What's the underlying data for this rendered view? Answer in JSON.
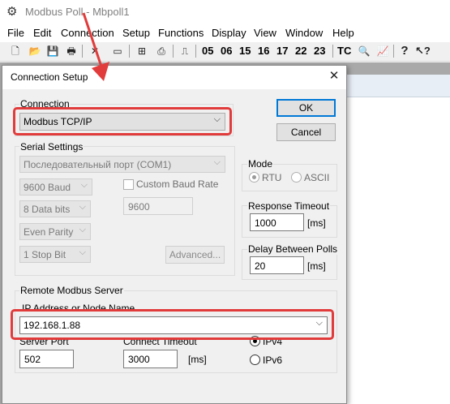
{
  "app": {
    "title": "Modbus Poll - Mbpoll1"
  },
  "menu": [
    "File",
    "Edit",
    "Connection",
    "Setup",
    "Functions",
    "Display",
    "View",
    "Window",
    "Help"
  ],
  "toolbar": {
    "function_codes": [
      "05",
      "06",
      "15",
      "16",
      "17",
      "22",
      "23"
    ],
    "tc_label": "TC"
  },
  "dialog": {
    "title": "Connection Setup",
    "connection": {
      "label": "Connection",
      "value": "Modbus TCP/IP"
    },
    "ok": "OK",
    "cancel": "Cancel",
    "serial": {
      "label": "Serial Settings",
      "port": "Последовательный порт (COM1)",
      "baud": "9600 Baud",
      "databits": "8 Data bits",
      "parity": "Even Parity",
      "stopbits": "1 Stop Bit",
      "custom_baud_label": "Custom Baud Rate",
      "custom_baud_value": "9600",
      "advanced": "Advanced..."
    },
    "mode": {
      "label": "Mode",
      "rtu": "RTU",
      "ascii": "ASCII"
    },
    "response_timeout": {
      "label": "Response Timeout",
      "value": "1000",
      "unit": "[ms]"
    },
    "delay_between_polls": {
      "label": "Delay Between Polls",
      "value": "20",
      "unit": "[ms]"
    },
    "remote": {
      "label": "Remote Modbus Server",
      "ip_label": "IP Address or Node Name",
      "ip_value": "192.168.1.88",
      "port_label": "Server Port",
      "port_value": "502",
      "timeout_label": "Connect Timeout",
      "timeout_value": "3000",
      "timeout_unit": "[ms]",
      "ipv4": "IPv4",
      "ipv6": "IPv6"
    }
  },
  "colors": {
    "highlight": "#e23b3b",
    "default_button": "#0078d7"
  }
}
